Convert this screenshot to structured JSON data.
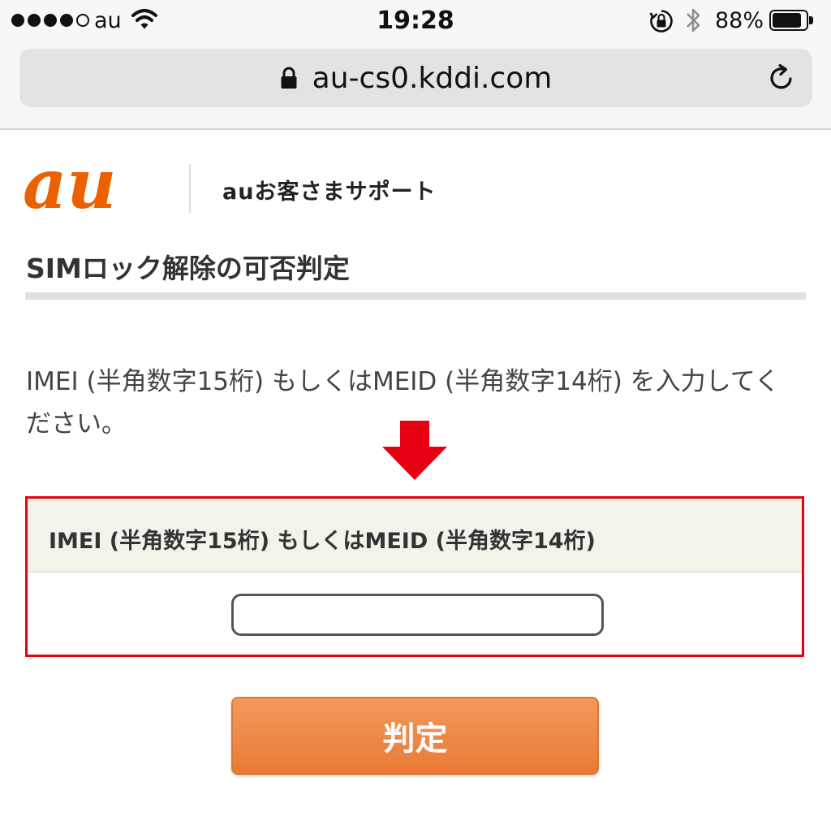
{
  "status_bar": {
    "carrier": "au",
    "time": "19:28",
    "battery_percent": "88%",
    "battery_level": 0.88,
    "signal_strength": 4,
    "signal_max": 5,
    "icons": [
      "signal-dots-icon",
      "wifi-icon",
      "orientation-lock-icon",
      "bluetooth-icon",
      "battery-icon"
    ]
  },
  "browser": {
    "url": "au-cs0.kddi.com",
    "icons": [
      "lock-icon",
      "reload-icon"
    ]
  },
  "header": {
    "logo_text": "au",
    "support_title": "auお客さまサポート"
  },
  "main": {
    "page_title": "SIMロック解除の可否判定",
    "instruction": "IMEI (半角数字15桁) もしくはMEID (半角数字14桁) を入力してください。",
    "form": {
      "label": "IMEI (半角数字15桁) もしくはMEID (半角数字14桁)",
      "input_value": "",
      "input_placeholder": ""
    },
    "submit_label": "判定"
  },
  "colors": {
    "brand_orange": "#eb6100",
    "highlight_red": "#e60012",
    "button_orange": "#ec7d3a",
    "form_header_bg": "#f4f3e9"
  }
}
